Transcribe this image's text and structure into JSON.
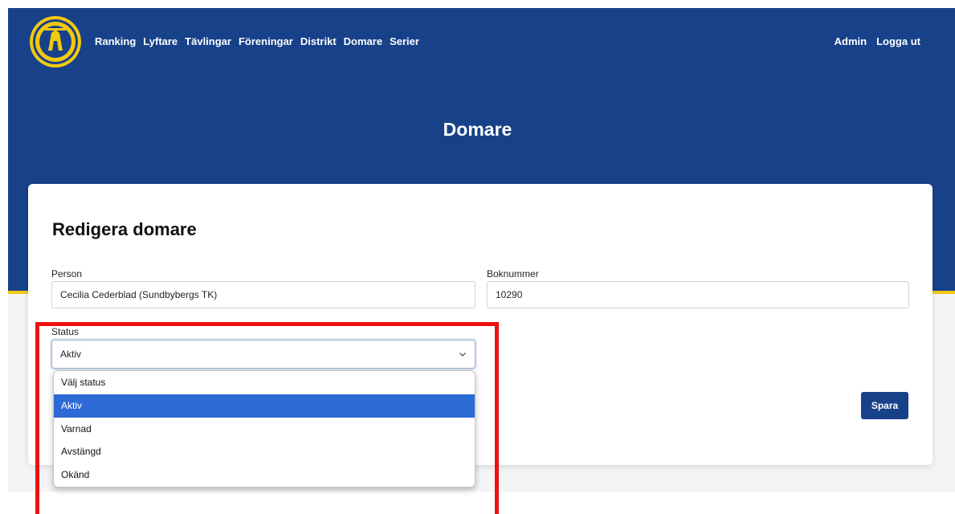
{
  "nav": {
    "links": [
      "Ranking",
      "Lyftare",
      "Tävlingar",
      "Föreningar",
      "Distrikt",
      "Domare",
      "Serier"
    ],
    "admin": "Admin",
    "logout": "Logga ut"
  },
  "page": {
    "title": "Domare"
  },
  "form": {
    "title": "Redigera domare",
    "person_label": "Person",
    "person_value": "Cecilia Cederblad (Sundbybergs TK)",
    "book_label": "Boknummer",
    "book_value": "10290",
    "status_label": "Status",
    "status_value": "Aktiv",
    "save_label": "Spara"
  },
  "dropdown": {
    "options": [
      "Välj status",
      "Aktiv",
      "Varnad",
      "Avstängd",
      "Okänd"
    ],
    "selected": "Aktiv"
  },
  "colors": {
    "header": "#174189",
    "accent_yellow": "#f2c811",
    "selected_option": "#2e6ad6",
    "highlight_frame": "#ee1111"
  },
  "icons": {
    "logo": "federation-logo",
    "select": "chevron-down-icon"
  }
}
